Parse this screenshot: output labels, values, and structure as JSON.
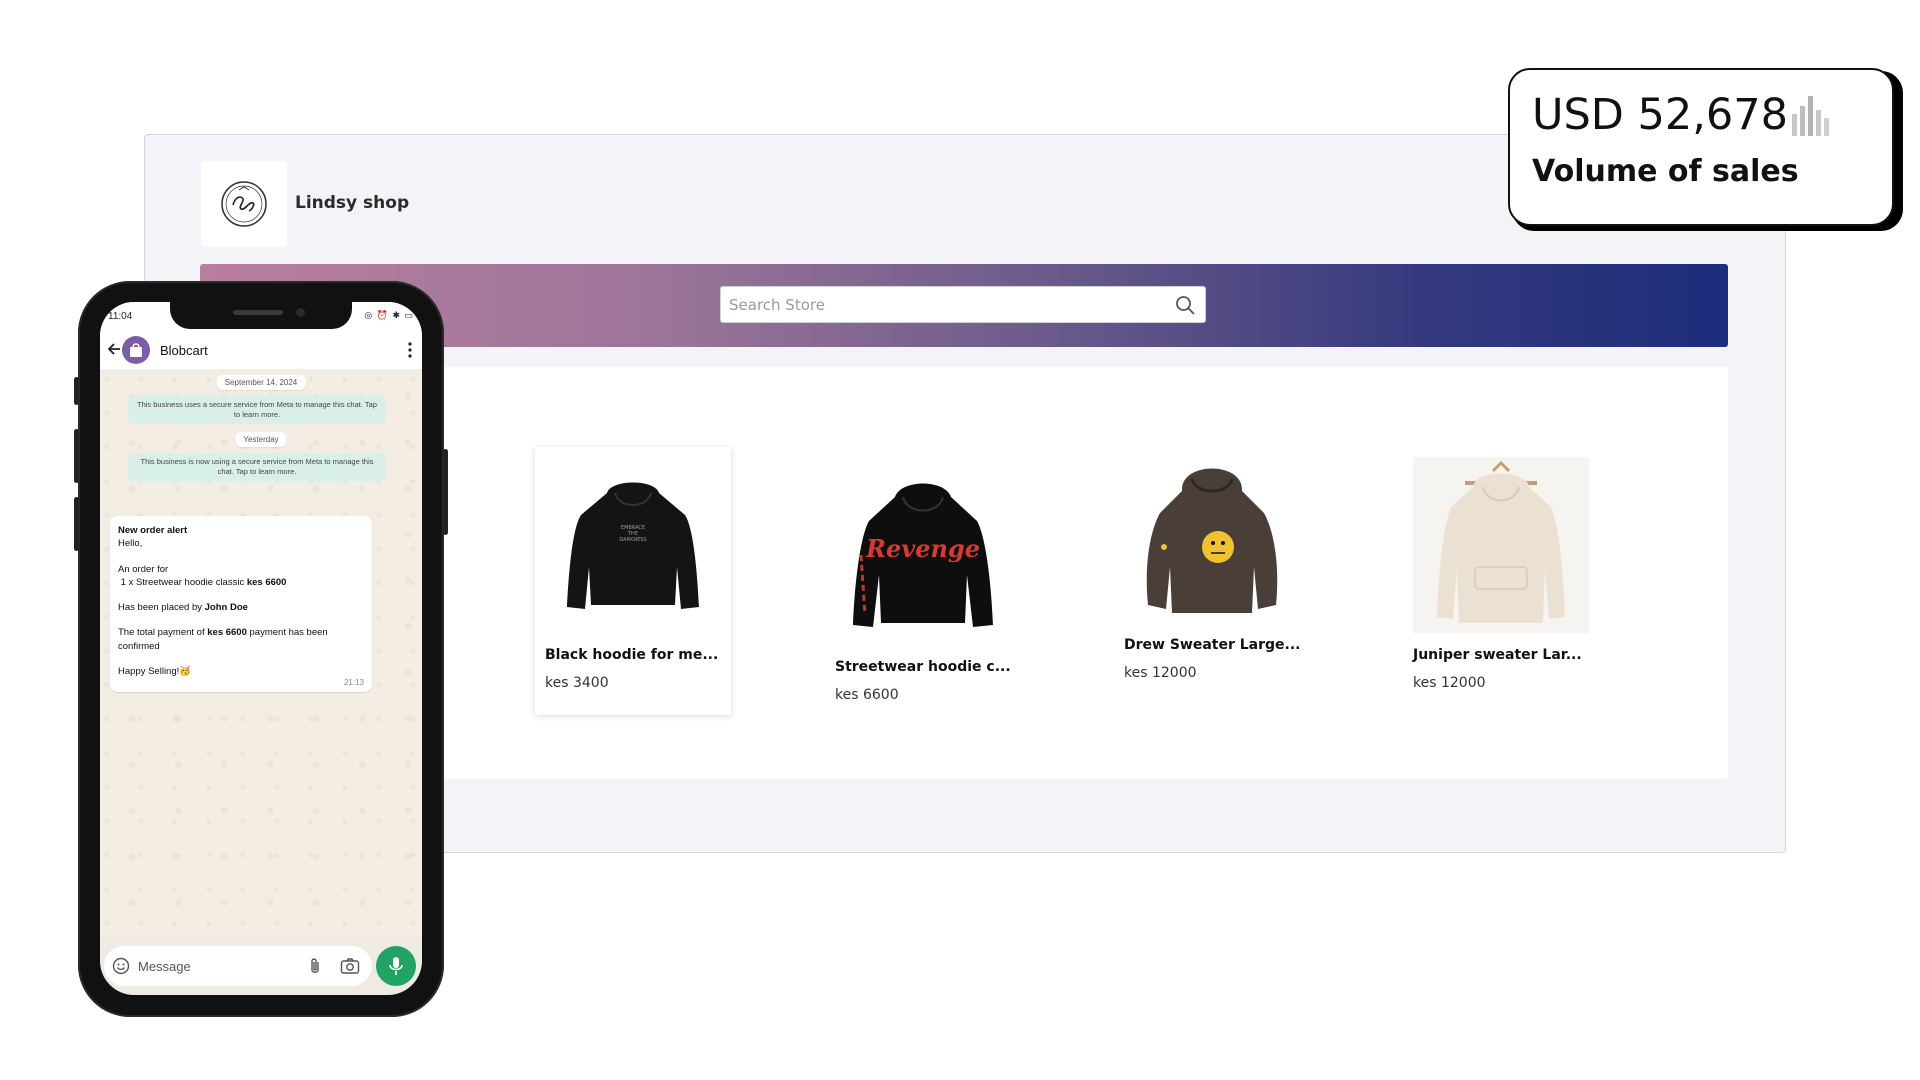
{
  "store": {
    "shop_name": "Lindsy shop",
    "search_placeholder": "Search Store",
    "products": [
      {
        "title": "Black hoodie for me...",
        "price": "kes 3400",
        "image": "black-hoodie"
      },
      {
        "title": "Streetwear hoodie c...",
        "price": "kes 6600",
        "image": "revenge-hoodie"
      },
      {
        "title": "Drew Sweater Large...",
        "price": "kes 12000",
        "image": "drew-sweater"
      },
      {
        "title": "Juniper sweater Lar...",
        "price": "kes 12000",
        "image": "juniper-sweater"
      }
    ],
    "colors": {
      "banner_start": "#b97f9e",
      "banner_end": "#1c2d7c"
    }
  },
  "sales_badge": {
    "amount": "USD 52,678",
    "label": "Volume of sales",
    "icon": "bar-chart-icon"
  },
  "phone": {
    "status_time": "11:04",
    "chat_name": "Blobcart",
    "date_pill_1": "September 14, 2024",
    "system_msg_1": "This business uses a secure service from Meta to manage this chat. Tap to learn more.",
    "date_pill_2": "Yesterday",
    "system_msg_2": "This business is now using a secure service from Meta to manage this chat. Tap to learn more.",
    "message": {
      "heading": "New order alert",
      "greeting": "Hello,",
      "order_intro": "An order for",
      "order_line_prefix": "1 x Streetwear hoodie classic",
      "order_amount": "kes 6600",
      "placed_prefix": "Has been placed by",
      "customer": "John Doe",
      "payment_prefix": "The total payment of",
      "payment_amount": "kes 6600",
      "payment_suffix": "payment has been confirmed",
      "signoff": "Happy Selling!",
      "signoff_emoji": "🥳",
      "time": "21:13"
    },
    "composer_placeholder": "Message",
    "colors": {
      "mic": "#21a366",
      "system_bubble": "#d9efea"
    }
  }
}
